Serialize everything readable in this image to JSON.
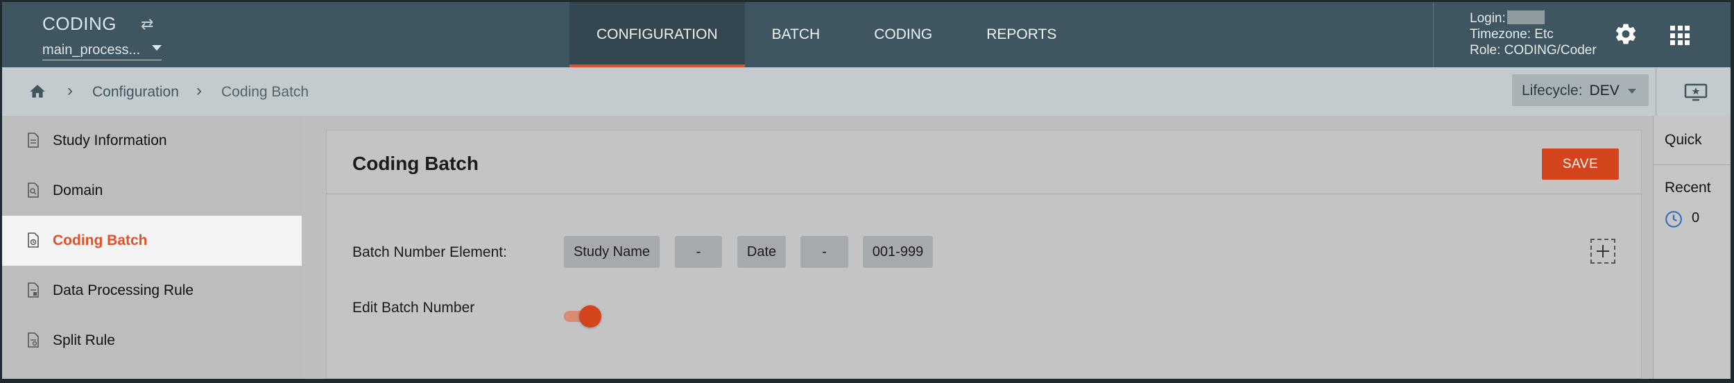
{
  "header": {
    "brand": "CODING",
    "process": "main_process...",
    "nav_tabs": [
      {
        "label": "CONFIGURATION",
        "active": true
      },
      {
        "label": "BATCH",
        "active": false
      },
      {
        "label": "CODING",
        "active": false
      },
      {
        "label": "REPORTS",
        "active": false
      }
    ],
    "user": {
      "login_label": "Login:",
      "timezone": "Timezone: Etc",
      "role": "Role: CODING/Coder"
    },
    "icons": {
      "swap": "swap-icon",
      "settings": "gear-icon",
      "apps": "apps-grid-icon"
    }
  },
  "breadcrumb": {
    "items": [
      "Configuration",
      "Coding Batch"
    ]
  },
  "lifecycle": {
    "label": "Lifecycle:",
    "value": "DEV"
  },
  "sidebar": {
    "items": [
      {
        "label": "Study Information",
        "active": false
      },
      {
        "label": "Domain",
        "active": false
      },
      {
        "label": "Coding Batch",
        "active": true
      },
      {
        "label": "Data Processing Rule",
        "active": false
      },
      {
        "label": "Split Rule",
        "active": false
      }
    ]
  },
  "main": {
    "title": "Coding Batch",
    "save_label": "SAVE",
    "batch_label": "Batch Number Element:",
    "chips": [
      "Study Name",
      "-",
      "Date",
      "-",
      "001-999"
    ],
    "edit_label": "Edit Batch Number",
    "edit_enabled": true
  },
  "right_panel": {
    "quick": "Quick",
    "recent": "Recent",
    "recent_count": "0"
  },
  "colors": {
    "header_bg": "#3f5560",
    "accent": "#d3441d",
    "active_tab_underline": "#e0522a"
  }
}
